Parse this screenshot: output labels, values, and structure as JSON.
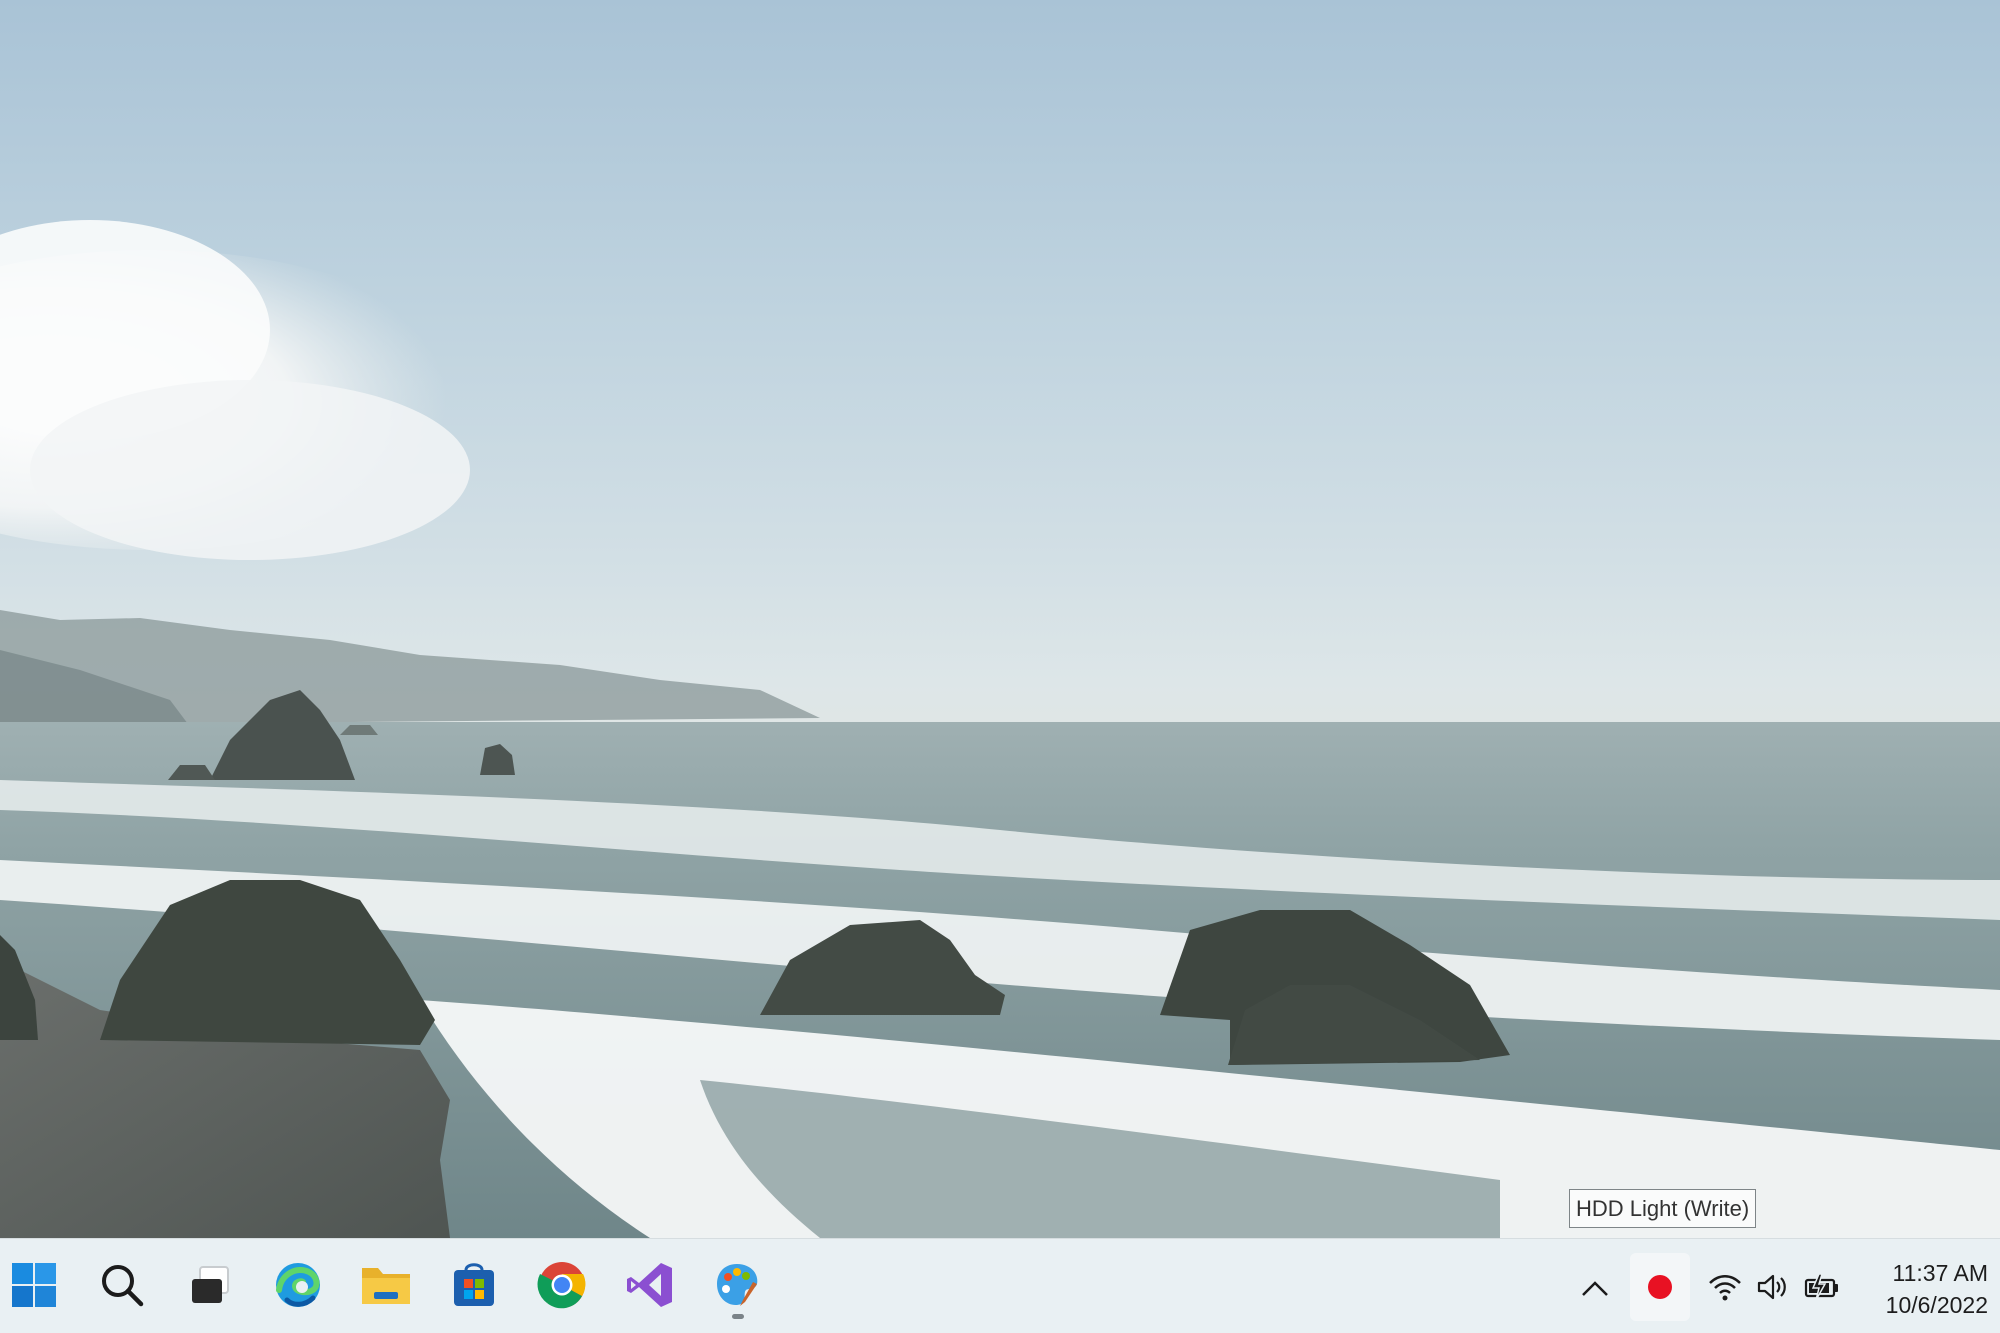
{
  "desktop": {
    "wallpaper": "coastal-sea-stacks-landscape"
  },
  "taskbar": {
    "pinned": [
      {
        "name": "start-button",
        "icon": "windows-logo-icon"
      },
      {
        "name": "search-button",
        "icon": "search-icon"
      },
      {
        "name": "task-view-button",
        "icon": "task-view-icon"
      },
      {
        "name": "edge-button",
        "icon": "edge-icon"
      },
      {
        "name": "file-explorer-button",
        "icon": "folder-icon"
      },
      {
        "name": "store-button",
        "icon": "store-icon"
      },
      {
        "name": "chrome-button",
        "icon": "chrome-icon"
      },
      {
        "name": "visual-studio-button",
        "icon": "visual-studio-icon"
      },
      {
        "name": "paint-button",
        "icon": "paint-palette-icon",
        "running": true
      }
    ],
    "tray": {
      "chevron_icon": "chevron-up-icon",
      "hdd_icon": "red-dot-icon",
      "hdd_color": "#e81123",
      "wifi_icon": "wifi-icon",
      "volume_icon": "volume-icon",
      "battery_icon": "battery-charging-icon"
    },
    "clock": {
      "time": "11:37 AM",
      "date": "10/6/2022"
    }
  },
  "tooltip": {
    "text": "HDD Light (Write)"
  }
}
